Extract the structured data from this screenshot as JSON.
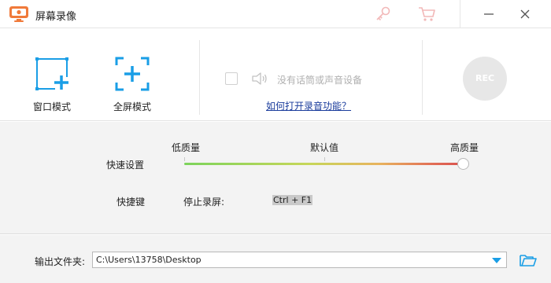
{
  "window": {
    "title": "屏幕录像"
  },
  "modes": {
    "window_label": "窗口模式",
    "fullscreen_label": "全屏模式"
  },
  "audio": {
    "no_device_label": "没有话筒或声音设备",
    "howto_link": "如何打开录音功能？"
  },
  "rec": {
    "label": "REC"
  },
  "quality": {
    "low": "低质量",
    "default": "默认值",
    "high": "高质量",
    "label": "快速设置",
    "level": 1.0
  },
  "hotkeys": {
    "label": "快捷键",
    "stop_label": "停止录屏:",
    "stop_value": "Ctrl + F1"
  },
  "output": {
    "label": "输出文件夹:",
    "path": "C:\\Users\\13758\\Desktop"
  },
  "colors": {
    "accent": "#1a9ee6",
    "app_icon": "#f07a3a",
    "link": "#1a3c9c"
  },
  "icons": {
    "app": "screen-recorder-icon",
    "key": "key-icon",
    "cart": "cart-icon",
    "minimize": "minimize-icon",
    "close": "close-icon",
    "speaker": "speaker-icon",
    "folder": "folder-open-icon"
  }
}
